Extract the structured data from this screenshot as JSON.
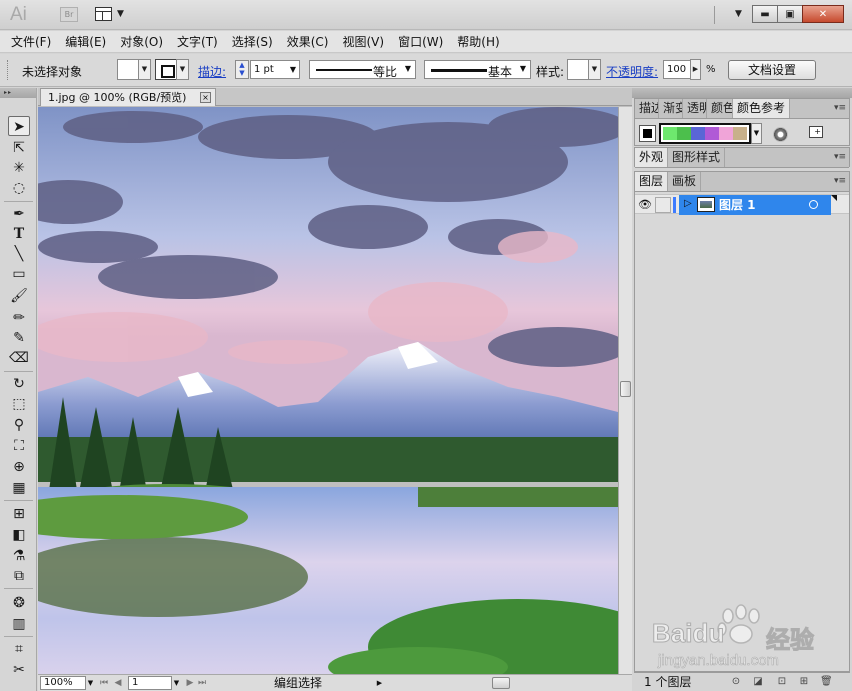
{
  "app": {
    "logo": "Ai",
    "bridge_badge": "Br"
  },
  "menu": [
    "文件(F)",
    "编辑(E)",
    "对象(O)",
    "文字(T)",
    "选择(S)",
    "效果(C)",
    "视图(V)",
    "窗口(W)",
    "帮助(H)"
  ],
  "control": {
    "no_selection": "未选择对象",
    "stroke_label": "描边:",
    "stroke_weight": "1 pt",
    "profile_label": "等比",
    "brush_label": "基本",
    "style_label": "样式:",
    "opacity_label": "不透明度:",
    "opacity_value": "100",
    "opacity_unit": "%",
    "doc_setup": "文档设置"
  },
  "document": {
    "tab_title": "1.jpg @ 100% (RGB/预览)",
    "close_glyph": "×"
  },
  "status": {
    "zoom": "100%",
    "artboard": "1",
    "mode": "编组选择"
  },
  "panels": {
    "color_tabs": [
      "描边",
      "渐变",
      "透明",
      "颜色",
      "颜色参考"
    ],
    "appearance_tabs": [
      "外观",
      "图形样式"
    ],
    "layers_tabs": [
      "图层",
      "画板"
    ],
    "layer_name": "图层 1",
    "layer_count": "1 个图层",
    "color_guide_colors": [
      "#6ee86e",
      "#4cbf4c",
      "#5a66d6",
      "#b05ad6",
      "#f0a4d8",
      "#c8b08a"
    ]
  },
  "watermark": {
    "brand": "Baidu",
    "brand_cn": "经验",
    "url": "jingyan.baidu.com"
  },
  "colors": {
    "accent_link": "#1a3fc4",
    "layer_selection": "#2f86ec",
    "close_button": "#c64a2e"
  }
}
